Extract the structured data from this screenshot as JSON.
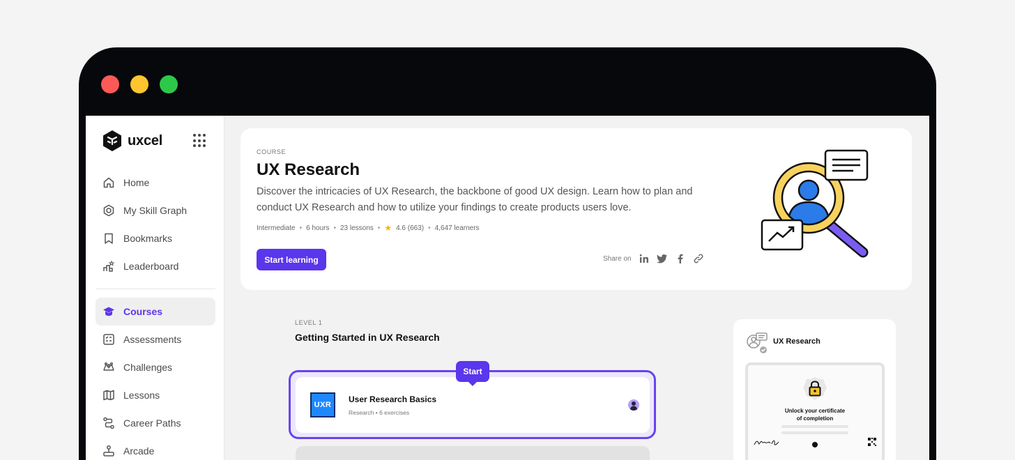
{
  "window": {
    "controls": [
      "close",
      "minimize",
      "maximize"
    ],
    "control_colors": {
      "close": "#fd5a57",
      "minimize": "#fec52e",
      "maximize": "#2dc84a"
    }
  },
  "brand": {
    "name": "uxcel",
    "accent": "#5a36ec"
  },
  "sidebar": {
    "items": [
      {
        "label": "Home",
        "icon": "home-icon"
      },
      {
        "label": "My Skill Graph",
        "icon": "skill-graph-icon"
      },
      {
        "label": "Bookmarks",
        "icon": "bookmark-icon"
      },
      {
        "label": "Leaderboard",
        "icon": "leaderboard-icon"
      },
      {
        "label": "Courses",
        "icon": "graduation-cap-icon",
        "active": true
      },
      {
        "label": "Assessments",
        "icon": "assessments-icon"
      },
      {
        "label": "Challenges",
        "icon": "challenges-icon"
      },
      {
        "label": "Lessons",
        "icon": "map-icon"
      },
      {
        "label": "Career Paths",
        "icon": "career-paths-icon"
      },
      {
        "label": "Arcade",
        "icon": "joystick-icon"
      }
    ]
  },
  "course": {
    "eyebrow": "COURSE",
    "title": "UX Research",
    "description": "Discover the intricacies of UX Research, the backbone of good UX design. Learn how to plan and conduct UX Research and how to utilize your findings to create products users love.",
    "level": "Intermediate",
    "duration": "6 hours",
    "lessons": "23 lessons",
    "rating": "4.6 (663)",
    "learners": "4,647 learners",
    "cta": "Start learning",
    "share_label": "Share on",
    "share_targets": [
      "linkedin-icon",
      "twitter-icon",
      "facebook-icon",
      "link-icon"
    ]
  },
  "level": {
    "label": "LEVEL 1",
    "title": "Getting Started in UX Research",
    "start_badge": "Start",
    "lesson": {
      "icon_text": "UXR",
      "title": "User Research Basics",
      "subtitle": "Research • 6 exercises"
    }
  },
  "certificate": {
    "title": "UX Research",
    "unlock_line1": "Unlock your certificate",
    "unlock_line2": "of completion"
  }
}
